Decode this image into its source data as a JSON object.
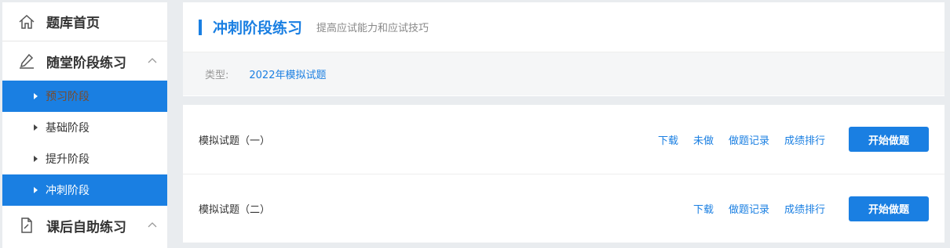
{
  "sidebar": {
    "home": {
      "label": "题库首页",
      "icon": "home-icon"
    },
    "practice": {
      "label": "随堂阶段练习",
      "icon": "pencil-icon",
      "items": [
        {
          "label": "预习阶段",
          "active": true
        },
        {
          "label": "基础阶段",
          "active": false
        },
        {
          "label": "提升阶段",
          "active": false
        },
        {
          "label": "冲刺阶段",
          "active": true
        }
      ]
    },
    "self_practice": {
      "label": "课后自助练习",
      "icon": "document-edit-icon"
    }
  },
  "header": {
    "title": "冲刺阶段练习",
    "subtitle": "提高应试能力和应试技巧",
    "filter_label": "类型:",
    "filter_value": "2022年模拟试题"
  },
  "exams": [
    {
      "title": "模拟试题（一）",
      "actions": [
        "下载",
        "未做",
        "做题记录",
        "成绩排行"
      ],
      "button": "开始做题"
    },
    {
      "title": "模拟试题（二）",
      "actions": [
        "下载",
        "做题记录",
        "成绩排行"
      ],
      "button": "开始做题"
    }
  ],
  "colors": {
    "accent": "#1a7fe2",
    "background": "#e9ecef"
  }
}
